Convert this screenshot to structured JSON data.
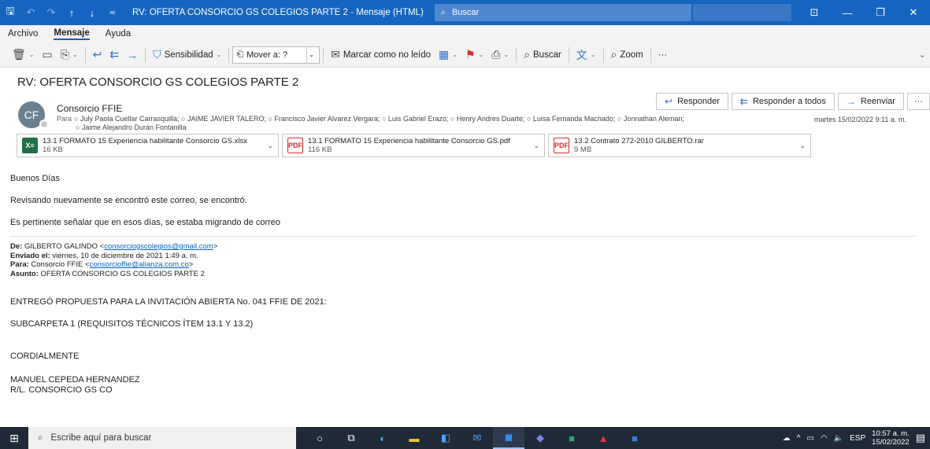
{
  "window": {
    "title": "RV: OFERTA CONSORCIO GS COLEGIOS PARTE 2  -  Mensaje (HTML)",
    "search_placeholder": "Buscar"
  },
  "menu": {
    "tabs": [
      "Archivo",
      "Mensaje",
      "Ayuda"
    ]
  },
  "ribbon": {
    "sensitivity": "Sensibilidad",
    "move_to": "Mover a: ?",
    "mark_unread": "Marcar como no leído",
    "search": "Buscar",
    "zoom": "Zoom",
    "more": "···"
  },
  "message": {
    "subject": "RV: OFERTA CONSORCIO GS COLEGIOS PARTE 2",
    "sender": "Consorcio FFIE",
    "avatar_initials": "CF",
    "to_label": "Para",
    "recipients_line1": "○ July Paola Cuellar Carrasquilla; ○ JAIME JAVIER TALERO; ○ Francisco Javier Alvarez Vergara; ○ Luis Gabriel Erazo; ○ Henry Andres Duarte; ○ Luisa Fernanda Machado; ○ Jonnathan Aleman;",
    "recipients_line2": "○ Jaime Alejandro Durán Fontanilla",
    "datetime": "martes 15/02/2022 9:11 a. m.",
    "reply": "Responder",
    "reply_all": "Responder a todos",
    "forward": "Reenviar",
    "more": "···"
  },
  "attachments": [
    {
      "name": "13.1 FORMATO 15 Experiencia habilitante Consorcio GS.xlsx",
      "size": "16 KB",
      "type": "X≡"
    },
    {
      "name": "13.1 FORMATO 15 Experiencia habilitante Consorcio GS.pdf",
      "size": "116 KB",
      "type": "PDF"
    },
    {
      "name": "13.2 Contrato 272-2010 GILBERTO.rar",
      "size": "9 MB",
      "type": "PDF"
    }
  ],
  "body": {
    "greeting": "Buenos Días",
    "line1": "Revisando nuevamente se encontró este correo, se encontró.",
    "line2": "Es pertinente señalar que en esos días, se estaba migrando de correo",
    "fwd_from_label": "De:",
    "fwd_from_name": "GILBERTO GALINDO <",
    "fwd_from_email": "consorciogscolegios@gmail.com",
    "fwd_sent_label": "Enviado el:",
    "fwd_sent": "viernes, 10 de diciembre de 2021 1:49 a. m.",
    "fwd_to_label": "Para:",
    "fwd_to_name": "Consorcio FFIE <",
    "fwd_to_email": "consorcioffie@alianza.com.co",
    "fwd_subject_label": "Asunto:",
    "fwd_subject": "OFERTA CONSORCIO GS COLEGIOS PARTE 2",
    "p1": "ENTREGÓ PROPUESTA PARA LA INVITACIÓN ABIERTA No. 041 FFIE DE 2021:",
    "p2": "SUBCARPETA 1 (REQUISITOS TÉCNICOS ÍTEM 13.1 Y 13.2)",
    "p3": "CORDIALMENTE",
    "sig1": "MANUEL CEPEDA HERNANDEZ",
    "sig2": "R/L. CONSORCIO GS CO"
  },
  "taskbar": {
    "search_placeholder": "Escribe aquí para buscar",
    "lang": "ESP",
    "time": "10:57 a. m.",
    "date": "15/02/2022"
  }
}
